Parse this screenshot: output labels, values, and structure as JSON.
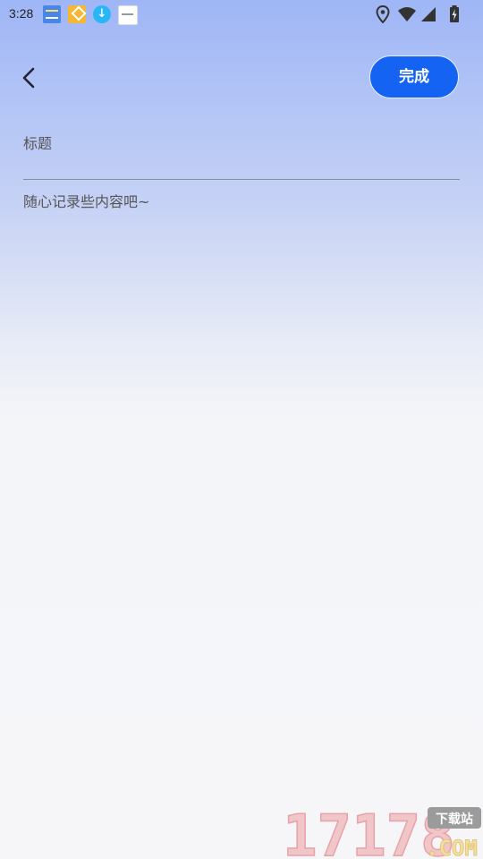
{
  "status_bar": {
    "time": "3:28",
    "notification_icons": [
      "news-app-icon",
      "game-app-icon",
      "download-icon",
      "browser-app-icon"
    ],
    "system_icons": [
      "location-icon",
      "wifi-icon",
      "signal-icon",
      "battery-charging-icon"
    ]
  },
  "header": {
    "back_icon": "chevron-left-icon",
    "done_label": "完成"
  },
  "editor": {
    "title_placeholder": "标题",
    "title_value": "",
    "content_placeholder": "随心记录些内容吧~",
    "content_value": ""
  },
  "watermark": {
    "number": "17178",
    "badge": "下载站",
    "suffix": ".COM"
  },
  "colors": {
    "accent": "#1563f3",
    "gradient_top": "#9fb6f6",
    "background": "#f6f6f9",
    "divider": "#8a8d96"
  }
}
